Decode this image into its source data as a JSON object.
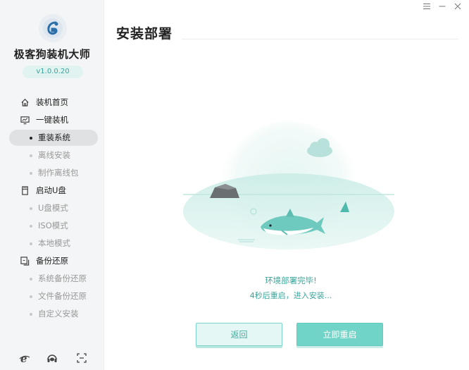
{
  "app": {
    "name": "极客狗装机大师",
    "version": "v1.0.0.20"
  },
  "window_controls": [
    "menu-icon",
    "minimize-icon",
    "close-icon"
  ],
  "sidebar": {
    "groups": [
      {
        "label": "装机首页",
        "icon": "home-icon"
      },
      {
        "label": "一键装机",
        "icon": "monitor-icon",
        "items": [
          {
            "label": "重装系统",
            "active": true
          },
          {
            "label": "离线安装"
          },
          {
            "label": "制作离线包"
          }
        ]
      },
      {
        "label": "启动U盘",
        "icon": "usb-icon",
        "items": [
          {
            "label": "U盘模式"
          },
          {
            "label": "ISO模式"
          },
          {
            "label": "本地模式"
          }
        ]
      },
      {
        "label": "备份还原",
        "icon": "backup-icon",
        "items": [
          {
            "label": "系统备份还原"
          },
          {
            "label": "文件备份还原"
          },
          {
            "label": "自定义安装"
          }
        ]
      }
    ],
    "bottom_icons": [
      "browser-icon",
      "headset-icon",
      "fullscreen-icon"
    ]
  },
  "main": {
    "title": "安装部署",
    "status_line1": "环境部署完毕!",
    "status_line2": "4秒后重启，进入安装...",
    "back_button": "返回",
    "restart_button": "立即重启"
  },
  "colors": {
    "accent": "#3aa69b",
    "button_fill": "#70d4c8",
    "sidebar_bg": "#f4f5f6"
  }
}
